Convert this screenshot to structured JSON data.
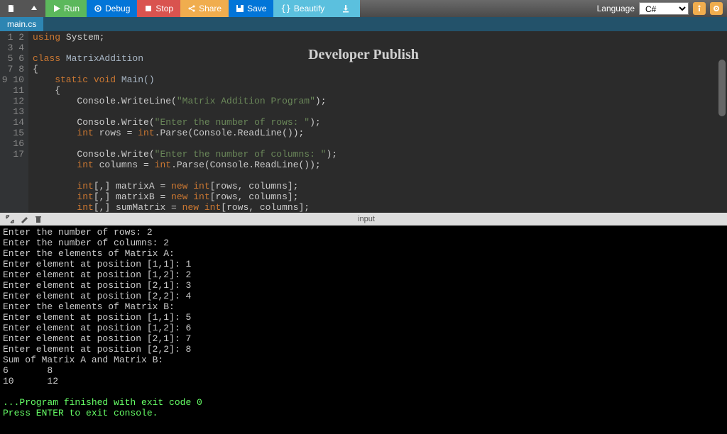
{
  "toolbar": {
    "run": "Run",
    "debug": "Debug",
    "stop": "Stop",
    "share": "Share",
    "save": "Save",
    "beautify": "Beautify",
    "language_label": "Language",
    "language_value": "C#"
  },
  "tab": {
    "name": "main.cs"
  },
  "watermark": "Developer Publish",
  "io_label": "input",
  "gutter": "1\n2\n3\n4\n5\n6\n7\n8\n9\n10\n11\n12\n13\n14\n15\n16\n17",
  "code": {
    "l1a": "using",
    "l1b": " System;",
    "l3a": "class",
    "l3b": " MatrixAddition",
    "l4": "{",
    "l5a": "    static void",
    "l5b": " Main()",
    "l6": "    {",
    "l7a": "        Console.WriteLine(",
    "l7s": "\"Matrix Addition Program\"",
    "l7b": ");",
    "l9a": "        Console.Write(",
    "l9s": "\"Enter the number of rows: \"",
    "l9b": ");",
    "l10a": "        int",
    "l10b": " rows = ",
    "l10c": "int",
    "l10d": ".Parse(Console.ReadLine());",
    "l12a": "        Console.Write(",
    "l12s": "\"Enter the number of columns: \"",
    "l12b": ");",
    "l13a": "        int",
    "l13b": " columns = ",
    "l13c": "int",
    "l13d": ".Parse(Console.ReadLine());",
    "l15a": "        int",
    "l15b": "[,] matrixA = ",
    "l15c": "new int",
    "l15d": "[rows, columns];",
    "l16a": "        int",
    "l16b": "[,] matrixB = ",
    "l16c": "new int",
    "l16d": "[rows, columns];",
    "l17a": "        int",
    "l17b": "[,] sumMatrix = ",
    "l17c": "new int",
    "l17d": "[rows, columns];"
  },
  "console": {
    "out": "Enter the number of rows: 2\nEnter the number of columns: 2\nEnter the elements of Matrix A:\nEnter element at position [1,1]: 1\nEnter element at position [1,2]: 2\nEnter element at position [2,1]: 3\nEnter element at position [2,2]: 4\nEnter the elements of Matrix B:\nEnter element at position [1,1]: 5\nEnter element at position [1,2]: 6\nEnter element at position [2,1]: 7\nEnter element at position [2,2]: 8\nSum of Matrix A and Matrix B:\n6       8\n10      12\n\n",
    "exit": "...Program finished with exit code 0\nPress ENTER to exit console."
  }
}
